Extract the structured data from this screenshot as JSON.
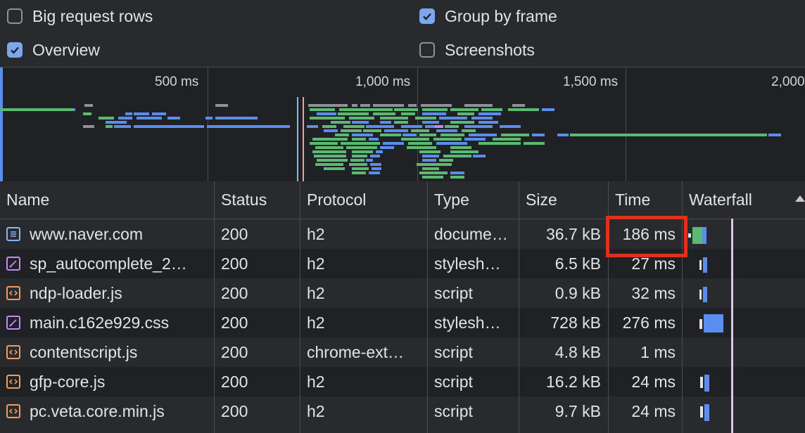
{
  "settings": {
    "big_request_rows": {
      "label": "Big request rows",
      "checked": false
    },
    "group_by_frame": {
      "label": "Group by frame",
      "checked": true
    },
    "overview": {
      "label": "Overview",
      "checked": true
    },
    "screenshots": {
      "label": "Screenshots",
      "checked": false
    }
  },
  "overview": {
    "ticks": [
      "500 ms",
      "1,000 ms",
      "1,500 ms",
      "2,000"
    ]
  },
  "table": {
    "columns": [
      "Name",
      "Status",
      "Protocol",
      "Type",
      "Size",
      "Time",
      "Waterfall"
    ],
    "rows": [
      {
        "name": "www.naver.com",
        "icon": "document-icon",
        "status": "200",
        "protocol": "h2",
        "type": "docume…",
        "size": "36.7 kB",
        "time": "186 ms"
      },
      {
        "name": "sp_autocomplete_2…",
        "icon": "stylesheet-icon",
        "status": "200",
        "protocol": "h2",
        "type": "stylesh…",
        "size": "6.5 kB",
        "time": "27 ms"
      },
      {
        "name": "ndp-loader.js",
        "icon": "script-icon",
        "status": "200",
        "protocol": "h2",
        "type": "script",
        "size": "0.9 kB",
        "time": "32 ms"
      },
      {
        "name": "main.c162e929.css",
        "icon": "stylesheet-icon",
        "status": "200",
        "protocol": "h2",
        "type": "stylesh…",
        "size": "728 kB",
        "time": "276 ms"
      },
      {
        "name": "contentscript.js",
        "icon": "script-icon",
        "status": "200",
        "protocol": "chrome-ext…",
        "type": "script",
        "size": "4.8 kB",
        "time": "1 ms"
      },
      {
        "name": "gfp-core.js",
        "icon": "script-icon",
        "status": "200",
        "protocol": "h2",
        "type": "script",
        "size": "16.2 kB",
        "time": "24 ms"
      },
      {
        "name": "pc.veta.core.min.js",
        "icon": "script-icon",
        "status": "200",
        "protocol": "h2",
        "type": "script",
        "size": "9.7 kB",
        "time": "24 ms"
      }
    ]
  },
  "colors": {
    "checkbox_on": "#7ca7ee",
    "highlight": "#e2301f",
    "bar_green": "#5bb974",
    "bar_blue": "#5b8def",
    "bar_gray": "#8f9196"
  }
}
